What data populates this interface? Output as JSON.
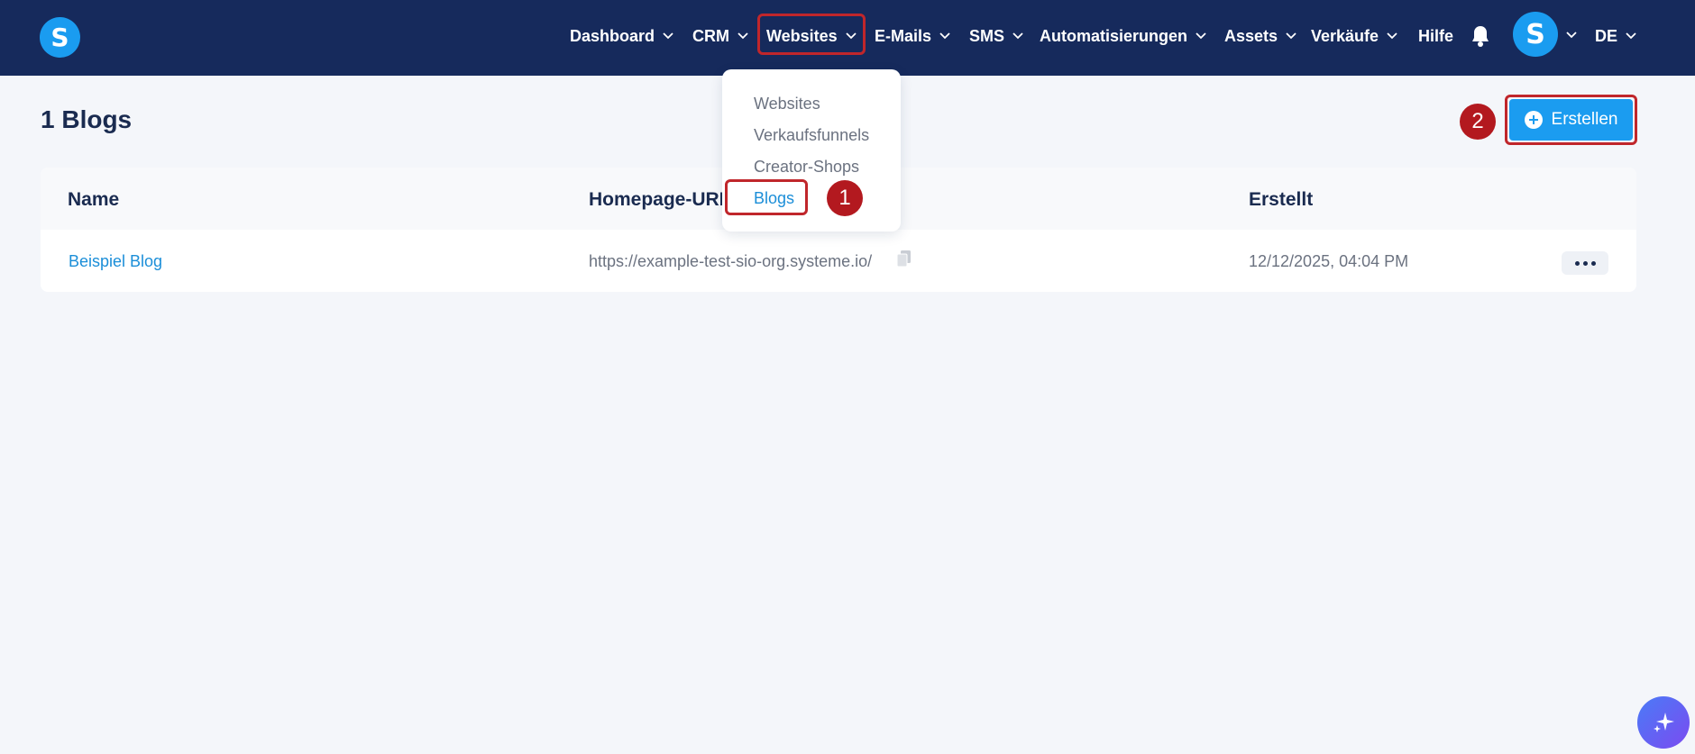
{
  "app": {
    "logo_letter": "S",
    "brand_color": "#1a9cf0",
    "nav_bg": "#162a5c"
  },
  "nav": {
    "items": [
      {
        "label": "Dashboard"
      },
      {
        "label": "CRM"
      },
      {
        "label": "Websites"
      },
      {
        "label": "E-Mails"
      },
      {
        "label": "SMS"
      },
      {
        "label": "Automatisierungen"
      },
      {
        "label": "Assets"
      },
      {
        "label": "Verkäufe"
      }
    ],
    "help_label": "Hilfe",
    "bell_icon": "bell-icon",
    "avatar_letter": "S",
    "language": "DE"
  },
  "websites_menu": {
    "items": [
      {
        "label": "Websites"
      },
      {
        "label": "Verkaufsfunnels"
      },
      {
        "label": "Creator-Shops"
      },
      {
        "label": "Blogs"
      }
    ]
  },
  "page": {
    "title": "1 Blogs",
    "create_label": "Erstellen"
  },
  "annotations": {
    "step1": "1",
    "step2": "2",
    "color": "#b3191f"
  },
  "table": {
    "headers": {
      "name": "Name",
      "homepage_url": "Homepage-URL",
      "created": "Erstellt"
    },
    "rows": [
      {
        "name": "Beispiel Blog",
        "homepage_url": "https://example-test-sio-org.systeme.io/",
        "created": "12/12/2025, 04:04 PM"
      }
    ]
  }
}
